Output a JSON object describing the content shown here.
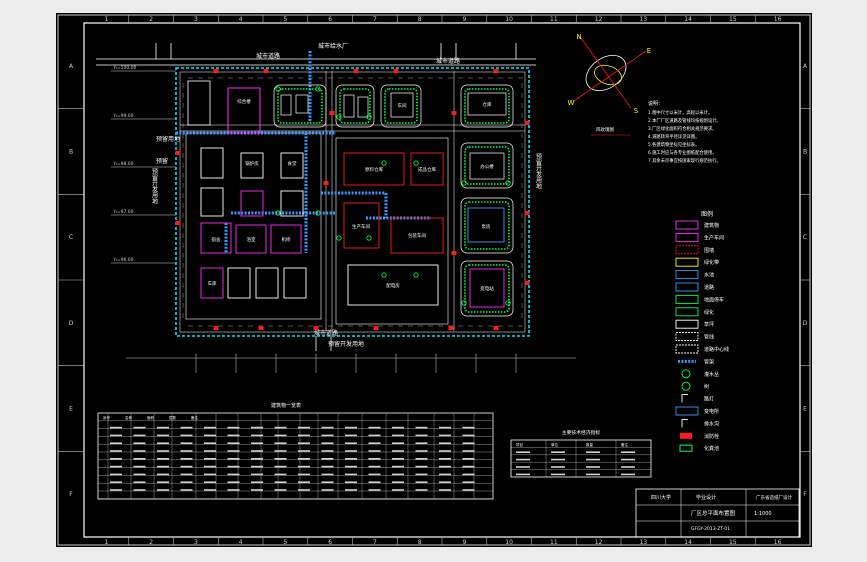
{
  "drawing": {
    "grid_cols": [
      "1",
      "2",
      "3",
      "4",
      "5",
      "6",
      "7",
      "8",
      "9",
      "10",
      "11",
      "12",
      "13",
      "14",
      "15",
      "16"
    ],
    "grid_rows": [
      "A",
      "B",
      "C",
      "D",
      "E",
      "F"
    ]
  },
  "plan": {
    "road_label_top": "城市道路",
    "road_label_top2": "城市道路",
    "factory_label": "城市给水厂",
    "road_label_bottom": "城市道路",
    "west_label": "预留开发用地",
    "east_label": "预留开发用地",
    "south_label": "预留开发用地",
    "west_corner_label": "预留用地",
    "buildings": [
      {
        "label": "综合楼"
      },
      {
        "label": "车间"
      },
      {
        "label": "仓库"
      },
      {
        "label": "办公楼"
      },
      {
        "label": "泵房"
      },
      {
        "label": "变电站"
      },
      {
        "label": "锅炉房"
      },
      {
        "label": "食堂"
      },
      {
        "label": "宿舍"
      },
      {
        "label": "浴室"
      },
      {
        "label": "机修"
      },
      {
        "label": "车库"
      },
      {
        "label": "原料仓库"
      },
      {
        "label": "成品仓库"
      },
      {
        "label": "生产车间"
      },
      {
        "label": "包装车间"
      },
      {
        "label": "配电房"
      },
      {
        "label": "门卫"
      }
    ],
    "elev_marks": [
      "h=100.00",
      "h=99.00",
      "h=98.00",
      "h=97.00",
      "h=96.00"
    ]
  },
  "compass": {
    "n": "N",
    "e": "E",
    "s": "S",
    "w": "W"
  },
  "notes": {
    "title": "说明：",
    "lines": [
      "1.图中尺寸以米计，高程以米计。",
      "2.本厂厂区道路及管线均按规划设计。",
      "3.厂区绿化面积符合相关规范要求。",
      "4.道路转弯半径详见详图。",
      "5.各建筑物坐标见坐标表。",
      "6.施工时应与各专业图纸配合使用。",
      "7.其余未尽事宜按国家现行规范执行。"
    ],
    "wind_label": "风玫瑰图"
  },
  "legend": {
    "title": "图例",
    "items": [
      {
        "label": "建筑物"
      },
      {
        "label": "生产车间"
      },
      {
        "label": "围墙"
      },
      {
        "label": "绿化带"
      },
      {
        "label": "水池"
      },
      {
        "label": "道路"
      },
      {
        "label": "地面停车"
      },
      {
        "label": "绿化"
      },
      {
        "label": "草坪"
      },
      {
        "label": "管线"
      },
      {
        "label": "道路中心线"
      },
      {
        "label": "管架"
      },
      {
        "label": "灌木丛"
      },
      {
        "label": "树"
      },
      {
        "label": "路灯"
      },
      {
        "label": "变电所"
      },
      {
        "label": "排水沟"
      },
      {
        "label": "消防栓"
      },
      {
        "label": "化粪池"
      }
    ]
  },
  "table1": {
    "title": "建筑物一览表",
    "headers": [
      "序号",
      "名称",
      "面积",
      "层数",
      "备注"
    ]
  },
  "table2": {
    "title": "主要技术经济指标",
    "headers": [
      "项目",
      "单位",
      "数量",
      "备注"
    ]
  },
  "title_block": {
    "school": "四川大学",
    "project": "毕业设计",
    "drawing_name": "厂区总平面布置图",
    "company": "广东省造纸厂设计",
    "code": "GFGY-2013-ZT-01",
    "scale": "1:1000"
  },
  "colors": {
    "frame": "#ffffff",
    "wall": "#00e5ff",
    "building": "#ff2dff",
    "road": "#ffffff",
    "green": "#00ff44",
    "pipe": "#3b9bff",
    "hydrant": "#ff1a1a",
    "accent": "#ffff00"
  }
}
